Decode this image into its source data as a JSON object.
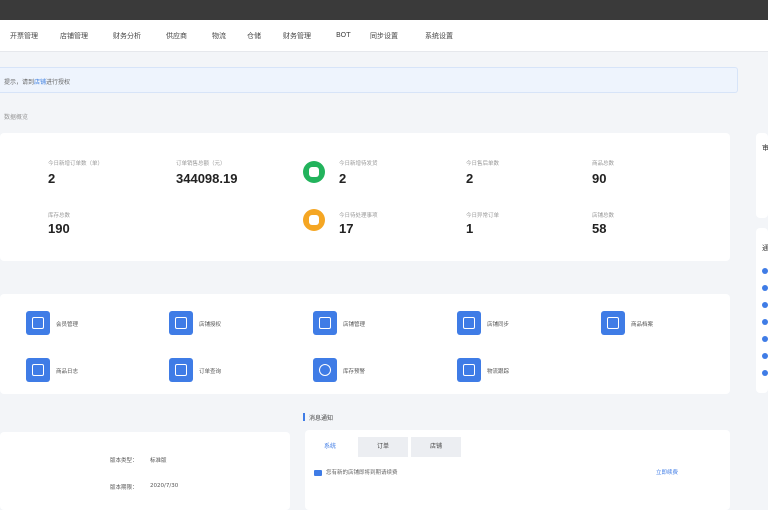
{
  "topbar": {},
  "nav": {
    "items": [
      "开票管理",
      "店铺管理",
      "财务分析",
      "供应商",
      "物流",
      "仓储",
      "财务管理",
      "BOT",
      "同步设置",
      "系统设置"
    ]
  },
  "notice": {
    "text_before": "提示，请到",
    "link_text": "店铺",
    "text_after": "进行授权"
  },
  "section_caption": "数据概览",
  "stats": [
    {
      "label": "今日新增订单数（单）",
      "value": "2"
    },
    {
      "label": "订单销售总额（元）",
      "value": "344098.19"
    },
    {
      "label": "今日新增待发货",
      "value": "2"
    },
    {
      "label": "今日售后单数",
      "value": "2"
    },
    {
      "label": "商品总数",
      "value": "90"
    },
    {
      "label": "库存总数",
      "value": "190"
    },
    {
      "label": "今日待处理事项",
      "value": "17"
    },
    {
      "label": "今日异常订单",
      "value": "1"
    },
    {
      "label": "店铺总数",
      "value": "58"
    }
  ],
  "colors": {
    "accent": "#3f7ce6",
    "green": "#22b35c",
    "orange": "#f5a623"
  },
  "quick_links": [
    "会员管理",
    "店铺授权",
    "店铺管理",
    "店铺同步",
    "商品档案",
    "商品日志",
    "订单查询",
    "库存预警",
    "物流跟踪"
  ],
  "account": {
    "version_label": "版本类型：",
    "version_value": "标准版",
    "expire_label": "版本期限：",
    "expire_value": "2020/7/30"
  },
  "messages": {
    "title": "消息通知",
    "tabs": [
      "系统",
      "订单",
      "店铺"
    ],
    "item_text": "您有新的店铺即将到期请续费",
    "item_link": "立即续费"
  },
  "right_panel": {
    "title_a": "审",
    "title_b": "通"
  }
}
